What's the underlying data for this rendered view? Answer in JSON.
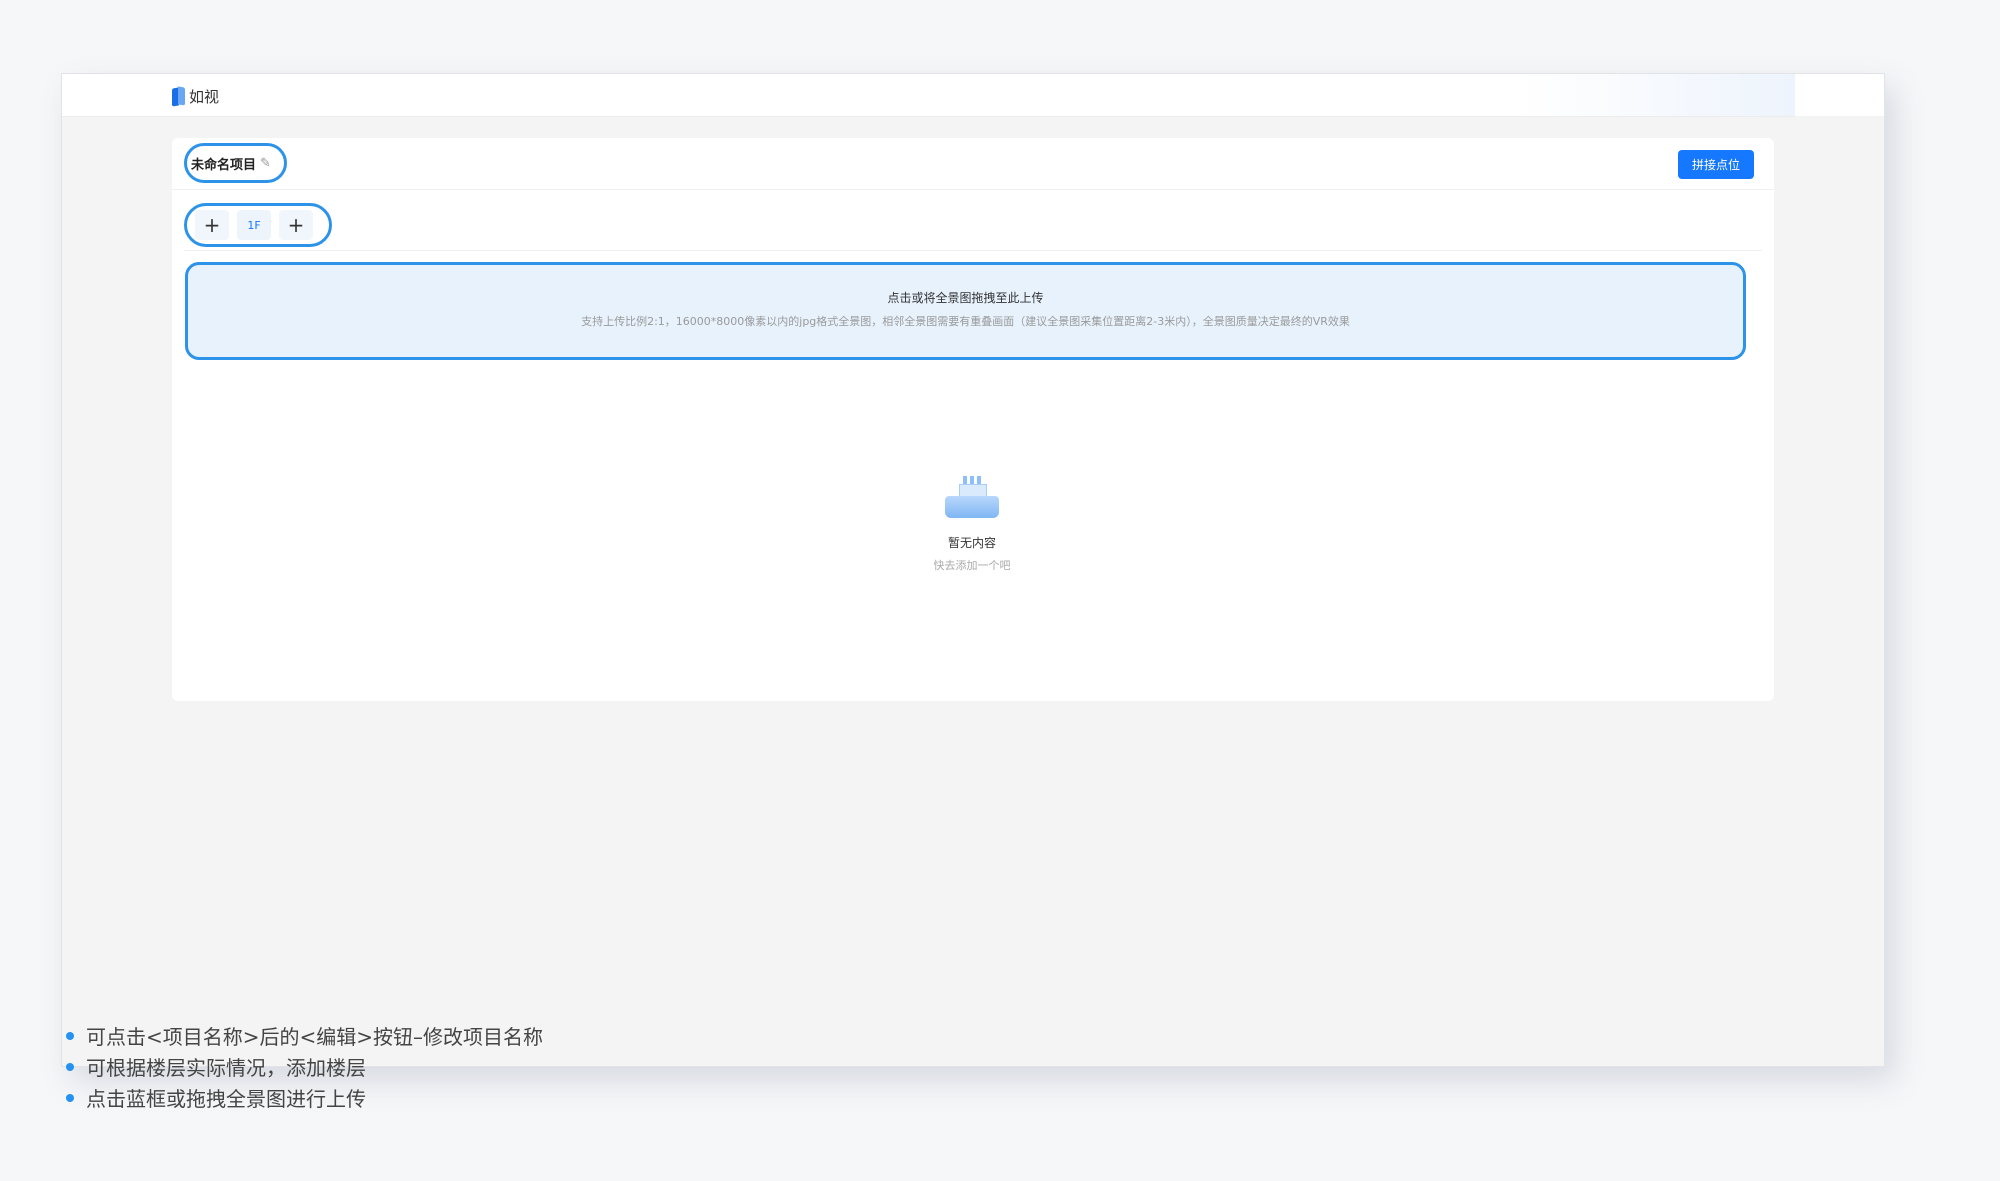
{
  "app": {
    "name": "如视"
  },
  "project": {
    "title": "未命名项目",
    "edit_icon": "pencil-icon"
  },
  "toolbar": {
    "stitch_label": "拼接点位"
  },
  "floors": {
    "add_before": "+",
    "tabs": [
      "1F"
    ],
    "add_after": "+"
  },
  "upload": {
    "title": "点击或将全景图拖拽至此上传",
    "hint": "支持上传比例2:1，16000*8000像素以内的jpg格式全景图，相邻全景图需要有重叠画面（建议全景图采集位置距离2-3米内），全景图质量决定最终的VR效果"
  },
  "empty": {
    "title": "暂无内容",
    "subtitle": "快去添加一个吧"
  },
  "notes": [
    "可点击<项目名称>后的<编辑>按钮–修改项目名称",
    "可根据楼层实际情况，添加楼层",
    "点击蓝框或拖拽全景图进行上传"
  ],
  "colors": {
    "accent": "#1677ff",
    "highlight": "#2d93e8",
    "upload_bg": "#e8f2fd"
  }
}
